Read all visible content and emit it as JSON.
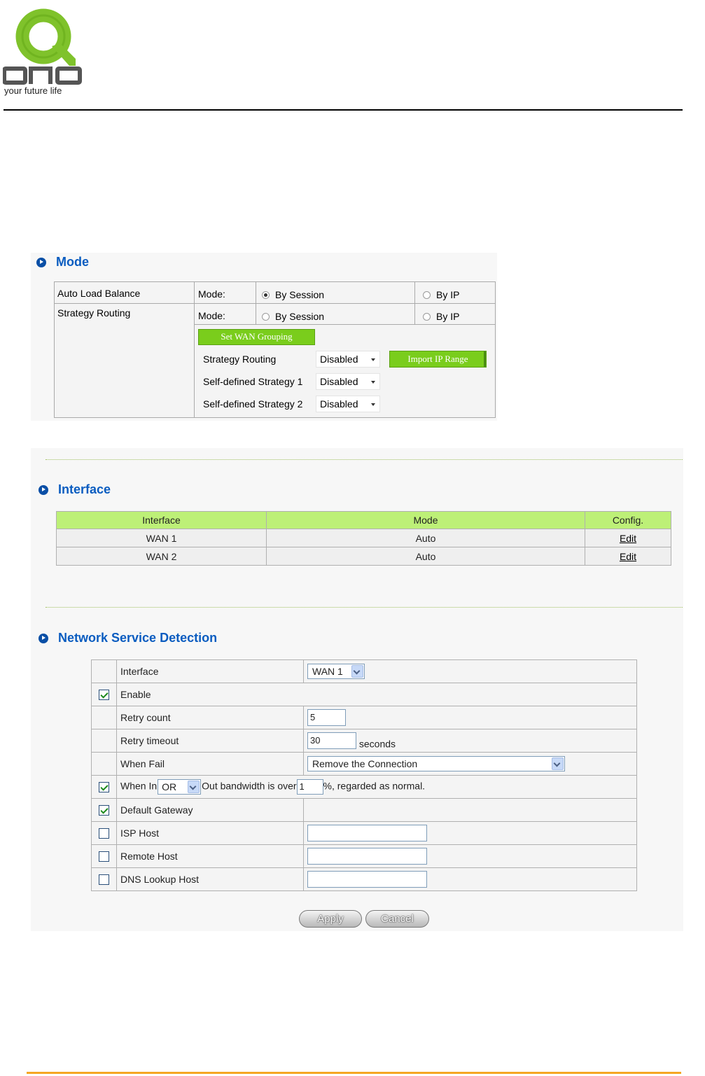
{
  "header": {
    "logo_tagline": "your future life"
  },
  "sections": {
    "mode": "Mode",
    "interface": "Interface",
    "nsd": "Network Service Detection"
  },
  "mode": {
    "rows": [
      {
        "label": "Auto Load Balance",
        "mode_label": "Mode:",
        "opt1": "By Session",
        "opt2": "By IP",
        "selected": "By Session"
      },
      {
        "label": "Strategy Routing",
        "mode_label": "Mode:",
        "opt1": "By Session",
        "opt2": "By IP",
        "selected": ""
      }
    ],
    "set_wan_grouping": "Set WAN Grouping",
    "strategy_routing_label": "Strategy Routing",
    "strategy_routing_value": "Disabled",
    "import_ip_range": "Import IP Range",
    "self1_label": "Self-defined Strategy 1",
    "self1_value": "Disabled",
    "self2_label": "Self-defined Strategy 2",
    "self2_value": "Disabled"
  },
  "interface_table": {
    "headers": [
      "Interface",
      "Mode",
      "Config."
    ],
    "rows": [
      {
        "interface": "WAN 1",
        "mode": "Auto",
        "config": "Edit"
      },
      {
        "interface": "WAN 2",
        "mode": "Auto",
        "config": "Edit"
      }
    ]
  },
  "nsd": {
    "interface_label": "Interface",
    "interface_value": "WAN 1",
    "enable_label": "Enable",
    "retry_count_label": "Retry count",
    "retry_count_value": "5",
    "retry_timeout_label": "Retry timeout",
    "retry_timeout_value": "30",
    "retry_timeout_unit": "seconds",
    "when_fail_label": "When Fail",
    "when_fail_value": "Remove the Connection",
    "when_in_prefix": "When In",
    "when_in_op": "OR",
    "when_in_mid": "Out bandwidth is over",
    "when_in_value": "1",
    "when_in_suffix": "%,  regarded as normal.",
    "default_gateway_label": "Default Gateway",
    "isp_host_label": "ISP Host",
    "remote_host_label": "Remote Host",
    "dns_lookup_label": "DNS Lookup Host",
    "checks": {
      "enable": true,
      "when_in": true,
      "default_gateway": true,
      "isp_host": false,
      "remote_host": false,
      "dns_lookup": false
    }
  },
  "buttons": {
    "apply": "Apply",
    "cancel": "Cancel"
  },
  "colors": {
    "accent_green": "#7acd1c",
    "header_green": "#bdf077",
    "title_blue": "#0a5cc0",
    "footer_orange": "#f5a623"
  }
}
